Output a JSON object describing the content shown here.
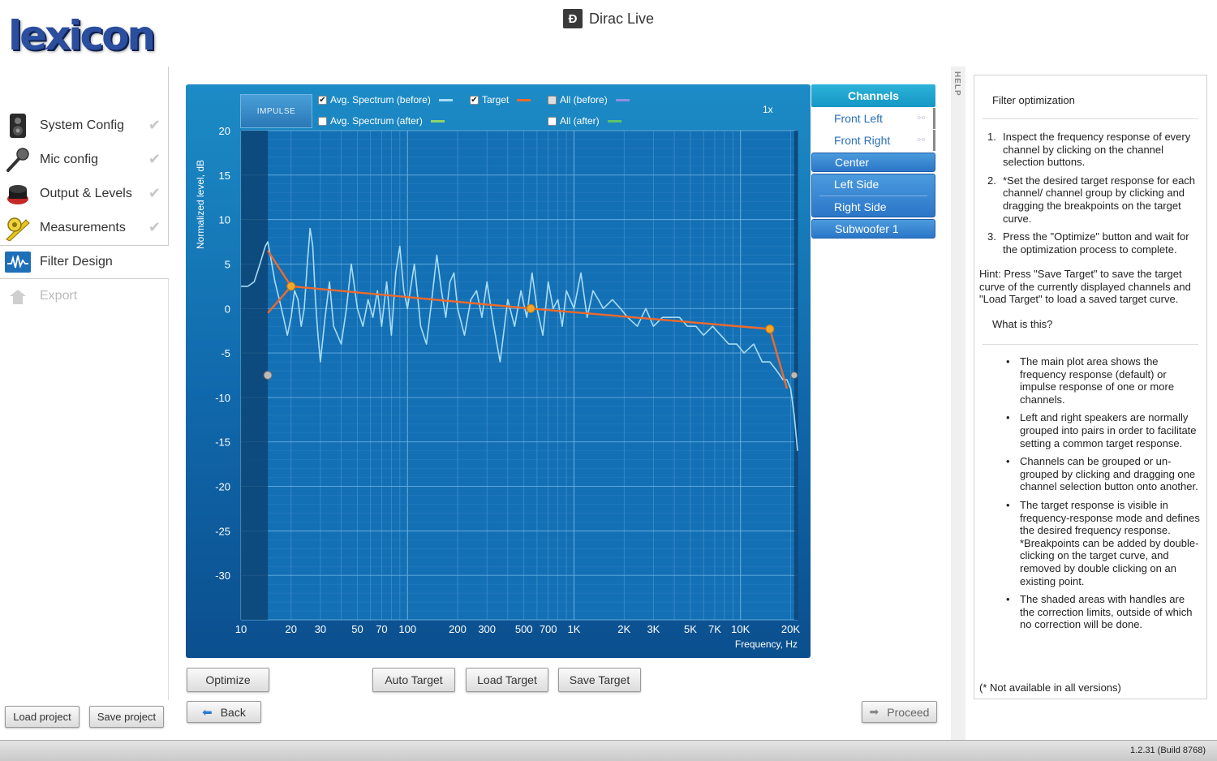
{
  "header": {
    "logo_text": "lexicon",
    "app_icon_glyph": "Đ",
    "app_title": "Dirac Live"
  },
  "sidebar": {
    "items": [
      {
        "label": "System Config",
        "icon": "speaker-icon",
        "done": true
      },
      {
        "label": "Mic config",
        "icon": "microphone-icon",
        "done": true
      },
      {
        "label": "Output & Levels",
        "icon": "level-knob-icon",
        "done": true
      },
      {
        "label": "Measurements",
        "icon": "tape-measure-icon",
        "done": true
      },
      {
        "label": "Filter Design",
        "icon": "waveform-icon",
        "active": true
      },
      {
        "label": "Export",
        "icon": "export-icon",
        "disabled": true
      }
    ],
    "check_glyph": "✔",
    "load_project": "Load project",
    "save_project": "Save project"
  },
  "plot": {
    "impulse_tab": "IMPULSE",
    "zoom": "1x",
    "legend": [
      {
        "label": "Avg. Spectrum (before)",
        "checked": true,
        "color": "#a8dcf7"
      },
      {
        "label": "Avg. Spectrum (after)",
        "checked": false,
        "color": "#8fd46b"
      },
      {
        "label": "Target",
        "checked": true,
        "color": "#ef6a2b"
      },
      {
        "label": "All (before)",
        "checked": false,
        "color": "#8f8fe6"
      },
      {
        "label": "All (after)",
        "checked": false,
        "color": "#5cc46b"
      }
    ],
    "check_glyph": "✔"
  },
  "chart_data": {
    "type": "line",
    "title": "",
    "xlabel": "Frequency, Hz",
    "ylabel": "Normalized level, dB",
    "xscale": "log",
    "xlim": [
      10,
      22000
    ],
    "ylim": [
      -35,
      20
    ],
    "x_ticks": [
      10,
      20,
      30,
      50,
      70,
      100,
      200,
      300,
      500,
      700,
      1000,
      2000,
      3000,
      5000,
      7000,
      10000,
      20000
    ],
    "x_tick_labels": [
      "10",
      "20",
      "30",
      "50",
      "70",
      "100",
      "200",
      "300",
      "500",
      "700",
      "1K",
      "2K",
      "3K",
      "5K",
      "7K",
      "10K",
      "20K"
    ],
    "y_ticks": [
      20,
      15,
      10,
      5,
      0,
      -5,
      -10,
      -15,
      -20,
      -25,
      -30
    ],
    "y_tick_labels": [
      "20",
      "15",
      "10",
      "5",
      "0",
      "-5",
      "-10",
      "-15",
      "-20",
      "-25",
      "-30"
    ],
    "correction_limits": [
      14.5,
      21000
    ],
    "series": [
      {
        "name": "Target",
        "color": "#ef6a2b",
        "x": [
          14.5,
          20,
          550,
          15000,
          19000
        ],
        "y": [
          6.5,
          2.5,
          0,
          -2.3,
          -9
        ]
      },
      {
        "name": "Target",
        "color": "#ef6a2b",
        "x": [
          14.5,
          20
        ],
        "y": [
          -0.5,
          2.5
        ]
      },
      {
        "name": "Avg. Spectrum (before)",
        "color": "#a8dcf7",
        "x": [
          10,
          11,
          12,
          13,
          14,
          14.5,
          15,
          16,
          17,
          18,
          19,
          20,
          21,
          22,
          23,
          24,
          25,
          26,
          27,
          28,
          29,
          30,
          32,
          34,
          36,
          38,
          40,
          43,
          46,
          50,
          54,
          58,
          62,
          66,
          70,
          75,
          80,
          85,
          90,
          95,
          100,
          110,
          120,
          130,
          140,
          150,
          160,
          170,
          180,
          190,
          200,
          220,
          240,
          260,
          280,
          300,
          330,
          360,
          400,
          440,
          480,
          520,
          560,
          600,
          650,
          700,
          750,
          800,
          850,
          900,
          1000,
          1100,
          1200,
          1300,
          1400,
          1500,
          1700,
          1900,
          2100,
          2400,
          2700,
          3000,
          3400,
          3800,
          4300,
          4800,
          5400,
          6000,
          6800,
          7600,
          8500,
          9500,
          10500,
          12000,
          13500,
          15000,
          16500,
          18000,
          19000,
          20000,
          21000,
          22000
        ],
        "y": [
          2.5,
          2.5,
          3,
          5,
          7,
          7.5,
          6,
          3,
          1,
          -1,
          -3,
          -1,
          2,
          1,
          -2,
          0,
          5,
          9,
          7,
          1,
          -3,
          -6,
          -1,
          3,
          -2,
          -3,
          -4,
          0,
          5,
          0,
          -2,
          1,
          -1,
          2,
          -2,
          3,
          -3,
          4,
          7,
          2,
          0,
          5,
          -2,
          -4,
          1,
          6,
          2,
          -1,
          3,
          4,
          0,
          -3,
          1,
          2,
          -1,
          3,
          -2,
          -6,
          1,
          -2,
          2,
          -1,
          4,
          0,
          -3,
          3,
          0,
          1,
          -2,
          2,
          0,
          4,
          -1,
          2,
          1,
          0,
          1,
          0,
          -1,
          -2,
          0,
          -2,
          -1,
          -1,
          -1,
          -2,
          -2,
          -3,
          -2,
          -3,
          -4,
          -4,
          -5,
          -4,
          -6,
          -6,
          -7,
          -8,
          -8,
          -9,
          -12,
          -16
        ]
      }
    ]
  },
  "buttons": {
    "optimize": "Optimize",
    "auto_target": "Auto Target",
    "load_target": "Load Target",
    "save_target": "Save Target",
    "back": "Back",
    "proceed": "Proceed",
    "back_arrow": "⬅",
    "proceed_arrow": "➡"
  },
  "channels": {
    "title": "Channels",
    "link_glyph": "⚯",
    "items": [
      {
        "label": "Front Left",
        "grouped": true
      },
      {
        "label": "Front Right",
        "grouped": true
      },
      {
        "label": "Center"
      },
      {
        "label": "Left Side"
      },
      {
        "label": "Right Side"
      },
      {
        "label": "Subwoofer 1"
      }
    ]
  },
  "help": {
    "tab_label": "HELP",
    "title": "Filter optimization",
    "steps": [
      "Inspect the frequency response of every channel by clicking on the channel selection buttons.",
      "*Set the desired target response for each channel/ channel group by clicking and dragging the breakpoints on the target curve.",
      "Press the \"Optimize\" button and wait for the optimization process to complete."
    ],
    "hint": "Hint: Press \"Save Target\" to save the target curve of the currently displayed channels and \"Load Target\" to load a saved target curve.",
    "what_title": "What is this?",
    "bullets": [
      "The main plot area shows the frequency response (default) or impulse response of one or more channels.",
      "Left and right speakers are normally grouped into pairs in order to facilitate setting a common target response.",
      "Channels can be grouped or un-grouped by clicking and dragging one channel selection button onto another.",
      "The target response is visible in frequency-response mode and defines the desired frequency response. *Breakpoints can be added by double-clicking on the target curve, and removed by double clicking on an existing point.",
      "The shaded areas with handles are the correction limits, outside of which no correction will be done."
    ],
    "footnote": "(* Not available in all versions)"
  },
  "status": {
    "version": "1.2.31 (Build 8768)"
  }
}
